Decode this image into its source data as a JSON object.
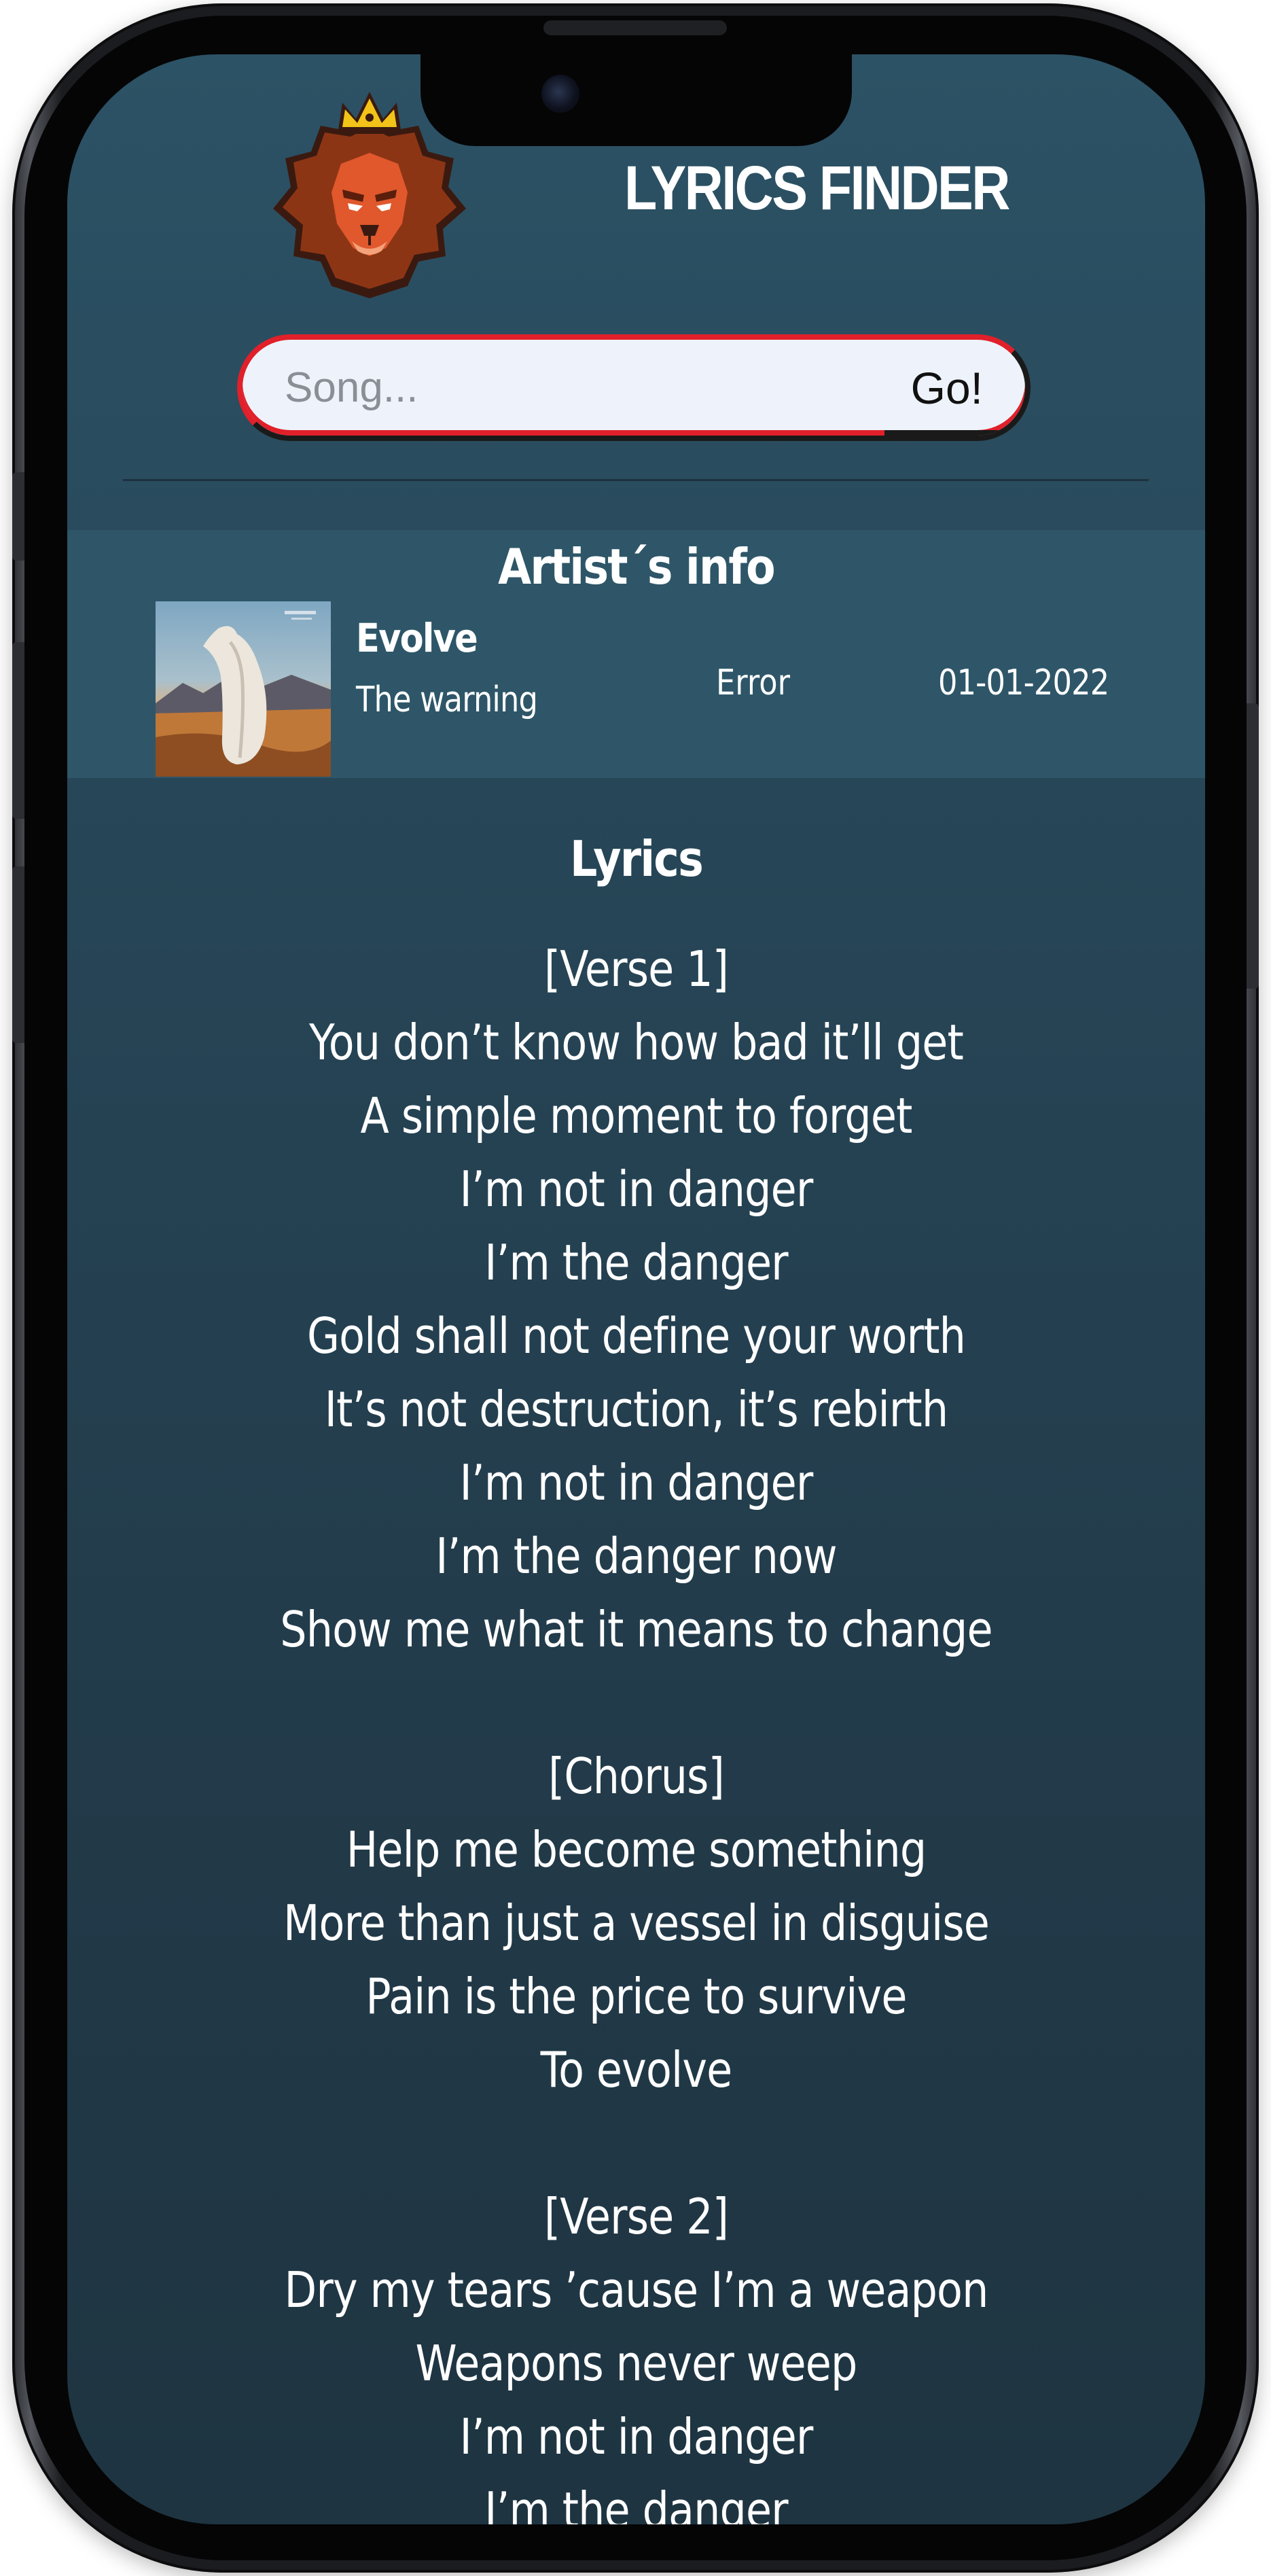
{
  "app": {
    "title": "LYRICS FINDER"
  },
  "search": {
    "placeholder": "Song...",
    "value": "",
    "go_label": "Go!"
  },
  "artist_info": {
    "heading": "Artist´s info",
    "song_title": "Evolve",
    "artist": "The warning",
    "status": "Error",
    "date": "01-01-2022",
    "album_art_icon": "album-cover-image"
  },
  "lyrics": {
    "heading": "Lyrics",
    "lines": [
      "[Verse 1]",
      "You don’t know how bad it’ll get",
      "A simple moment to forget",
      "I’m not in danger",
      "I’m the danger",
      "Gold shall not define your worth",
      "It’s not destruction, it’s rebirth",
      "I’m not in danger",
      "I’m the danger now",
      "Show me what it means to change",
      "",
      "[Chorus]",
      "Help me become something",
      "More than just a vessel in disguise",
      "Pain is the price to survive",
      "To evolve",
      "",
      "[Verse 2]",
      "Dry my tears ’cause I’m a weapon",
      "Weapons never weep",
      "I’m not in danger",
      "I’m the danger"
    ]
  },
  "colors": {
    "screen_top": "#2c5265",
    "screen_bottom": "#1e3441",
    "artist_panel": "#2e5668",
    "search_accent": "#e0202a",
    "lion_mane": "#8c3515",
    "crown": "#f2c318"
  },
  "icons": {
    "logo": "lion-crown-logo"
  }
}
